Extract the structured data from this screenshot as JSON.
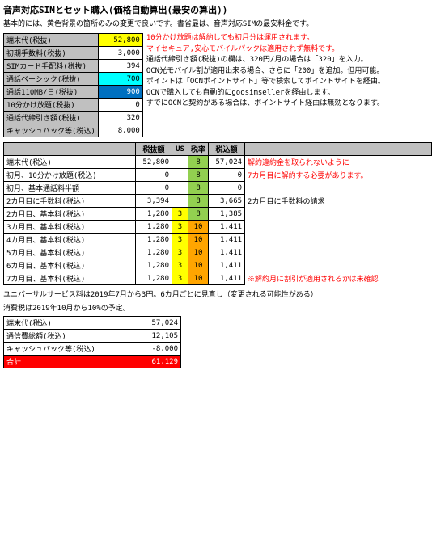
{
  "title": "音声対応SIMとセット購入(価格自動算出(最安の算出))",
  "subtitle": "基本的には、黄色背景の箇所のみの変更で良いです。書省最は、音声対応SIMの最安料金です。",
  "left_table": {
    "rows": [
      {
        "label": "端末代(税抜)",
        "value": "52,800",
        "style": "yellow"
      },
      {
        "label": "初期手数料(税抜)",
        "value": "3,000",
        "style": "normal"
      },
      {
        "label": "SIMカード手配料(税抜)",
        "value": "394",
        "style": "normal"
      },
      {
        "label": "通話ベーシック(税抜)",
        "value": "700",
        "style": "cyan"
      },
      {
        "label": "通話110MB/日(税抜)",
        "value": "900",
        "style": "blue"
      },
      {
        "label": "10分かけ放題(税抜)",
        "value": "0",
        "style": "normal"
      },
      {
        "label": "通話代締引き額(税抜)",
        "value": "320",
        "style": "normal"
      },
      {
        "label": "キャッシュバック等(税込)",
        "value": "8,000",
        "style": "normal"
      }
    ]
  },
  "right_notices": [
    {
      "text": "10分かけ放題は解約しても初月分は運用されます。",
      "color": "red"
    },
    {
      "text": "マイセキュア,安心モバイルパックは適用されず無料です。",
      "color": "red"
    },
    {
      "text": "通話代締引き額(税抜)の欄は、320円/月の場合は「320」を入力。",
      "color": "black"
    },
    {
      "text": "OCN光モバイル割が適用出来る場合、さらに「200」を追加。但用可能。",
      "color": "black"
    },
    {
      "text": "ポイントは「OCNポイントサイト」等で検索してポイントサイトを経由。",
      "color": "black"
    },
    {
      "text": "OCNで購入しても自動的にgoosimsellerを経由します。",
      "color": "black"
    },
    {
      "text": "すでにOCNと契約がある場合は、ポイントサイト経由は無効となります。",
      "color": "black"
    }
  ],
  "detail_headers": [
    "",
    "税抜額",
    "US",
    "税率",
    "税込額",
    ""
  ],
  "detail_rows": [
    {
      "label": "端末代(税込)",
      "zei": "52,800",
      "us": "",
      "rate": "8",
      "zeikomi": "57,024",
      "note": "解約違約金を取られないように",
      "note_color": "red",
      "row_style": "normal"
    },
    {
      "label": "初月、10分かけ放題(税込)",
      "zei": "0",
      "us": "",
      "rate": "8",
      "zeikomi": "0",
      "note": "7カ月目に解約する必要があります。",
      "note_color": "red",
      "row_style": "normal"
    },
    {
      "label": "初月、基本通話料半額",
      "zei": "0",
      "us": "",
      "rate": "8",
      "zeikomi": "0",
      "note": "",
      "note_color": "black",
      "row_style": "normal"
    },
    {
      "label": "2カ月目に手数料(税込)",
      "zei": "3,394",
      "us": "",
      "rate": "8",
      "zeikomi": "3,665",
      "note": "2カ月目に手数料の請求",
      "note_color": "black",
      "row_style": "normal"
    },
    {
      "label": "2カ月目、基本料(税込)",
      "zei": "1,280",
      "us": "3",
      "rate": "8",
      "zeikomi": "1,385",
      "note": "",
      "note_color": "black",
      "row_style": "normal"
    },
    {
      "label": "3カ月目、基本料(税込)",
      "zei": "1,280",
      "us": "3",
      "rate": "10",
      "zeikomi": "1,411",
      "note": "",
      "note_color": "black",
      "row_style": "normal"
    },
    {
      "label": "4カ月目、基本料(税込)",
      "zei": "1,280",
      "us": "3",
      "rate": "10",
      "zeikomi": "1,411",
      "note": "",
      "note_color": "black",
      "row_style": "normal"
    },
    {
      "label": "5カ月目、基本料(税込)",
      "zei": "1,280",
      "us": "3",
      "rate": "10",
      "zeikomi": "1,411",
      "note": "",
      "note_color": "black",
      "row_style": "normal"
    },
    {
      "label": "6カ月目、基本料(税込)",
      "zei": "1,280",
      "us": "3",
      "rate": "10",
      "zeikomi": "1,411",
      "note": "",
      "note_color": "black",
      "row_style": "normal"
    },
    {
      "label": "7カ月目、基本料(税込)",
      "zei": "1,280",
      "us": "3",
      "rate": "10",
      "zeikomi": "1,411",
      "note": "※解約月に割引が適用されるかは未確認",
      "note_color": "red",
      "row_style": "normal"
    }
  ],
  "universal_note": "ユニバーサルサービス料は2019年7月から3円。6カ月ごとに見直し（変更される可能性がある）",
  "tax_note": "消費税は2019年10月から10%の予定。",
  "summary_rows": [
    {
      "label": "端末代(税込)",
      "value": "57,024",
      "style": "normal"
    },
    {
      "label": "通信費総額(税込)",
      "value": "12,105",
      "style": "normal"
    },
    {
      "label": "キャッシュバック等(税込)",
      "value": "-8,000",
      "style": "normal"
    },
    {
      "label": "合計",
      "value": "61,129",
      "style": "red"
    }
  ]
}
